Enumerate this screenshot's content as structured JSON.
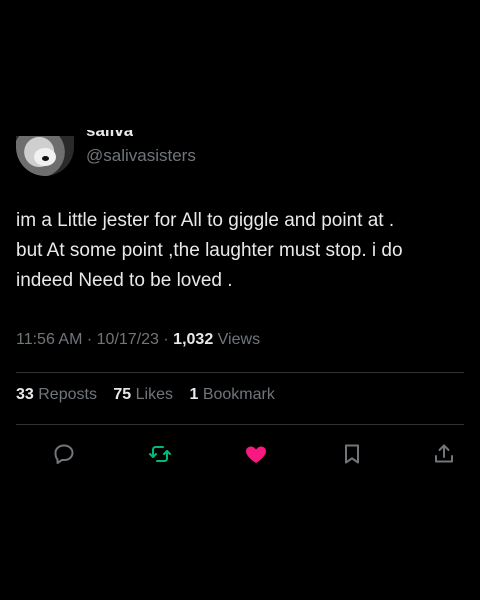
{
  "tweet": {
    "display_name": "saliva",
    "handle": "@salivasisters",
    "text": "im a Little jester for All to giggle and point at .\nbut At some point ,the laughter must stop. i do\nindeed Need to be loved .",
    "time": "11:56 AM",
    "date": "10/17/23",
    "views_count": "1,032",
    "views_label": "Views",
    "separator": "·"
  },
  "stats": {
    "reposts_count": "33",
    "reposts_label": "Reposts",
    "likes_count": "75",
    "likes_label": "Likes",
    "bookmarks_count": "1",
    "bookmarks_label": "Bookmark"
  },
  "actions": [
    {
      "icon": "reply-icon",
      "color": "#71767b"
    },
    {
      "icon": "repost-icon",
      "color": "#00ba7c",
      "active": true
    },
    {
      "icon": "like-icon",
      "color": "#f91880",
      "active": true
    },
    {
      "icon": "bookmark-icon",
      "color": "#71767b"
    },
    {
      "icon": "share-icon",
      "color": "#71767b"
    }
  ],
  "colors": {
    "background": "#000000",
    "text_primary": "#e7e9ea",
    "text_secondary": "#71767b",
    "divider": "#2f3336"
  }
}
